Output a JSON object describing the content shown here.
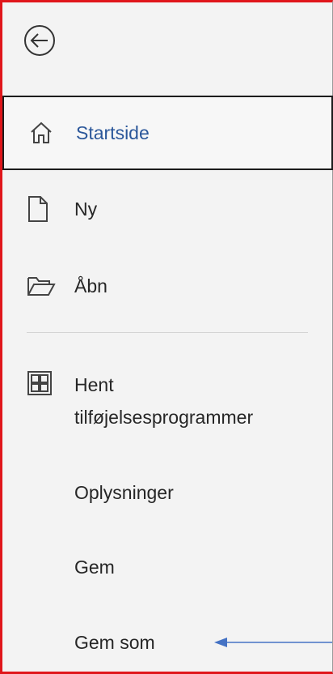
{
  "backstage": {
    "back_icon": "back-arrow-circle-icon",
    "items": [
      {
        "label": "Startside",
        "icon": "home-icon",
        "selected": true
      },
      {
        "label": "Ny",
        "icon": "new-document-icon"
      },
      {
        "label": "Åbn",
        "icon": "open-folder-icon"
      },
      {
        "label": "Hent",
        "label_line2": "tilføjelsesprogrammer",
        "icon": "addins-grid-icon"
      },
      {
        "label": "Oplysninger"
      },
      {
        "label": "Gem"
      },
      {
        "label": "Gem som"
      }
    ]
  },
  "annotation": {
    "arrow_icon": "pointer-arrow-icon",
    "target": "Gem som"
  },
  "colors": {
    "accent": "#2b579a",
    "highlight_border": "#e0161b",
    "arrow": "#4472c4",
    "background": "#f3f3f3"
  }
}
